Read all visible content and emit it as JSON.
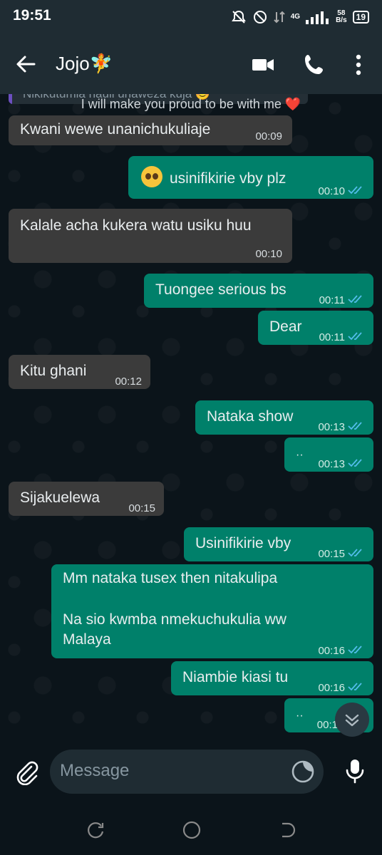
{
  "status_bar": {
    "time": "19:51",
    "network": "4G",
    "speed_value": "58",
    "speed_unit": "B/s",
    "battery": "19"
  },
  "header": {
    "contact_name": "Jojo🧚"
  },
  "chat": {
    "reply_preview": "Nikikutumia nauli unaweza kuja 😊",
    "overlay_caption": "I will make you proud to be with me ❤️",
    "messages": [
      {
        "dir": "in",
        "text": "Kwani wewe unanichukuliaje",
        "time": "00:09"
      },
      {
        "dir": "out",
        "text": "usinifikirie vby plz",
        "time": "00:10",
        "emoji": "pleading-face"
      },
      {
        "dir": "in",
        "text": "Kalale acha kukera watu usiku huu",
        "time": "00:10"
      },
      {
        "dir": "out",
        "text": "Tuongee serious bs",
        "time": "00:11"
      },
      {
        "dir": "out",
        "text": "Dear",
        "time": "00:11"
      },
      {
        "dir": "in",
        "text": "Kitu ghani",
        "time": "00:12"
      },
      {
        "dir": "out",
        "text": "Nataka show",
        "time": "00:13"
      },
      {
        "dir": "out",
        "text": "··",
        "time": "00:13"
      },
      {
        "dir": "in",
        "text": "Sijakuelewa",
        "time": "00:15"
      },
      {
        "dir": "out",
        "text": "Usinifikirie vby",
        "time": "00:15"
      },
      {
        "dir": "out",
        "text_line1": "Mm nataka tusex then nitakulipa",
        "text_line2": "Na sio kwmba nmekuchukulia ww",
        "text_line3": "Malaya",
        "time": "00:16"
      },
      {
        "dir": "out",
        "text": "Niambie kiasi tu",
        "time": "00:16"
      },
      {
        "dir": "out",
        "text": "··",
        "time": "00:1"
      }
    ]
  },
  "composer": {
    "placeholder": "Message"
  },
  "colors": {
    "incoming": "#3b3b3b",
    "outgoing": "#00806a",
    "read_ticks": "#53bdeb",
    "background": "#0b141a"
  }
}
